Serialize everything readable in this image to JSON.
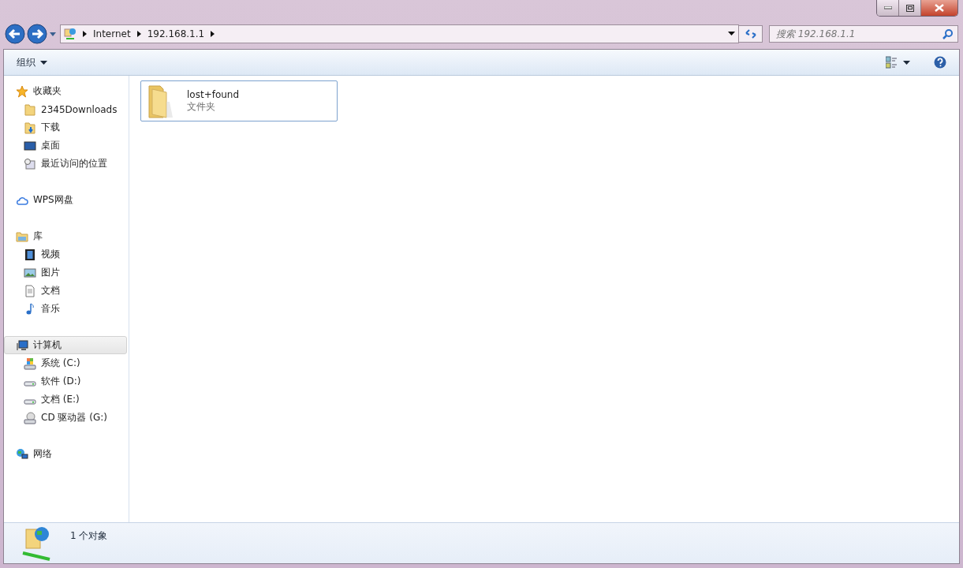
{
  "address": {
    "crumbs": [
      "Internet",
      "192.168.1.1"
    ]
  },
  "search": {
    "placeholder": "搜索 192.168.1.1"
  },
  "toolbar": {
    "organize": "组织"
  },
  "sidebar": {
    "groups": [
      {
        "label": "收藏夹",
        "kind": "star",
        "selected": false,
        "children": [
          {
            "label": "2345Downloads",
            "kind": "folder",
            "selected": false
          },
          {
            "label": "下载",
            "kind": "download",
            "selected": false
          },
          {
            "label": "桌面",
            "kind": "desktop",
            "selected": false
          },
          {
            "label": "最近访问的位置",
            "kind": "recent",
            "selected": false
          }
        ]
      },
      {
        "label": "WPS网盘",
        "kind": "cloud",
        "selected": false
      },
      {
        "label": "库",
        "kind": "library",
        "selected": false,
        "children": [
          {
            "label": "视频",
            "kind": "video",
            "selected": false
          },
          {
            "label": "图片",
            "kind": "picture",
            "selected": false
          },
          {
            "label": "文档",
            "kind": "document",
            "selected": false
          },
          {
            "label": "音乐",
            "kind": "music",
            "selected": false
          }
        ]
      },
      {
        "label": "计算机",
        "kind": "computer",
        "selected": true,
        "children": [
          {
            "label": "系统 (C:)",
            "kind": "sysdrive",
            "selected": false
          },
          {
            "label": "软件 (D:)",
            "kind": "drive",
            "selected": false
          },
          {
            "label": "文档 (E:)",
            "kind": "drive",
            "selected": false
          },
          {
            "label": "CD 驱动器 (G:)",
            "kind": "cd",
            "selected": false
          }
        ]
      },
      {
        "label": "网络",
        "kind": "network",
        "selected": false
      }
    ]
  },
  "files": [
    {
      "name": "lost+found",
      "type": "文件夹"
    }
  ],
  "status_bar": {
    "text": "1 个对象"
  }
}
